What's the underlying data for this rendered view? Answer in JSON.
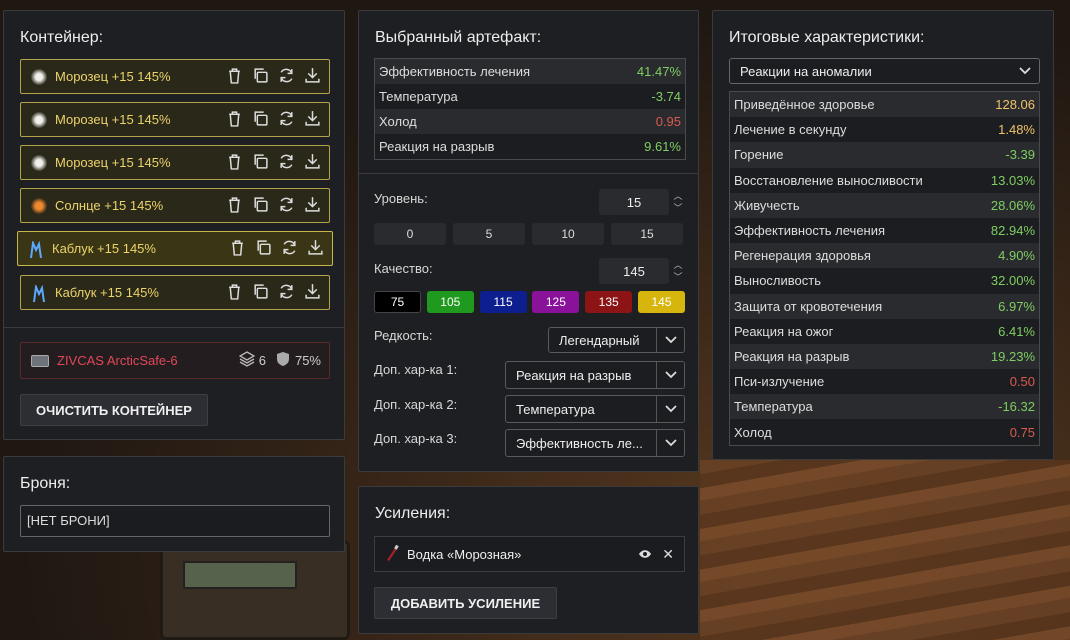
{
  "container": {
    "title": "Контейнер:",
    "slots": [
      {
        "name": "Морозец +15 145%",
        "color": "#f0f0ea"
      },
      {
        "name": "Морозец +15 145%",
        "color": "#f0f0ea"
      },
      {
        "name": "Морозец +15 145%",
        "color": "#f0f0ea"
      },
      {
        "name": "Солнце +15 145%",
        "color": "#f08a30"
      },
      {
        "name": "Каблук +15 145%",
        "color": "#5aa9ff"
      },
      {
        "name": "Каблук +15 145%",
        "color": "#5aa9ff"
      }
    ],
    "info": {
      "name": "ZIVCAS ArcticSafe-6",
      "capacity": "6",
      "protection": "75%"
    },
    "clear_label": "ОЧИСТИТЬ КОНТЕЙНЕР"
  },
  "armor": {
    "title": "Броня:",
    "value": "[НЕТ БРОНИ]"
  },
  "artifact": {
    "title": "Выбранный артефакт:",
    "stats": [
      {
        "name": "Эффективность лечения",
        "value": "41.47%",
        "kind": "pos"
      },
      {
        "name": "Температура",
        "value": "-3.74",
        "kind": "pos"
      },
      {
        "name": "Холод",
        "value": "0.95",
        "kind": "neg"
      },
      {
        "name": "Реакция на разрыв",
        "value": "9.61%",
        "kind": "pos"
      }
    ],
    "level_label": "Уровень:",
    "level_value": "15",
    "level_presets": [
      "0",
      "5",
      "10",
      "15"
    ],
    "quality_label": "Качество:",
    "quality_value": "145",
    "quality_presets": [
      {
        "label": "75",
        "color": "#000000",
        "border": "#000000"
      },
      {
        "label": "105",
        "color": "#1f9a1f",
        "border": "#1f9a1f"
      },
      {
        "label": "115",
        "color": "#0d1f8e",
        "border": "#0d1f8e"
      },
      {
        "label": "125",
        "color": "#8a129a",
        "border": "#8a129a"
      },
      {
        "label": "135",
        "color": "#8c1414",
        "border": "#8c1414"
      },
      {
        "label": "145",
        "color": "#d6b60c",
        "border": "#d6b60c"
      }
    ],
    "rarity_label": "Редкость:",
    "rarity_value": "Легендарный",
    "extra1_label": "Доп. хар-ка 1:",
    "extra1_value": "Реакция на разрыв",
    "extra2_label": "Доп. хар-ка 2:",
    "extra2_value": "Температура",
    "extra3_label": "Доп. хар-ка 3:",
    "extra3_value": "Эффективность ле..."
  },
  "boosts": {
    "title": "Усиления:",
    "items": [
      {
        "name": "Водка «Морозная»"
      }
    ],
    "add_label": "ДОБАВИТЬ УСИЛЕНИЕ"
  },
  "totals": {
    "title": "Итоговые характеристики:",
    "filter_value": "Реакции на аномалии",
    "stats": [
      {
        "name": "Приведённое здоровье",
        "value": "128.06",
        "kind": "hl"
      },
      {
        "name": "Лечение в секунду",
        "value": "1.48%",
        "kind": "hl"
      },
      {
        "name": "Горение",
        "value": "-3.39",
        "kind": "pos"
      },
      {
        "name": "Восстановление выносливости",
        "value": "13.03%",
        "kind": "pos"
      },
      {
        "name": "Живучесть",
        "value": "28.06%",
        "kind": "pos"
      },
      {
        "name": "Эффективность лечения",
        "value": "82.94%",
        "kind": "pos"
      },
      {
        "name": "Регенерация здоровья",
        "value": "4.90%",
        "kind": "pos"
      },
      {
        "name": "Выносливость",
        "value": "32.00%",
        "kind": "pos"
      },
      {
        "name": "Защита от кровотечения",
        "value": "6.97%",
        "kind": "pos"
      },
      {
        "name": "Реакция на ожог",
        "value": "6.41%",
        "kind": "pos"
      },
      {
        "name": "Реакция на разрыв",
        "value": "19.23%",
        "kind": "pos"
      },
      {
        "name": "Пси-излучение",
        "value": "0.50",
        "kind": "neg"
      },
      {
        "name": "Температура",
        "value": "-16.32",
        "kind": "pos"
      },
      {
        "name": "Холод",
        "value": "0.75",
        "kind": "neg"
      }
    ]
  }
}
